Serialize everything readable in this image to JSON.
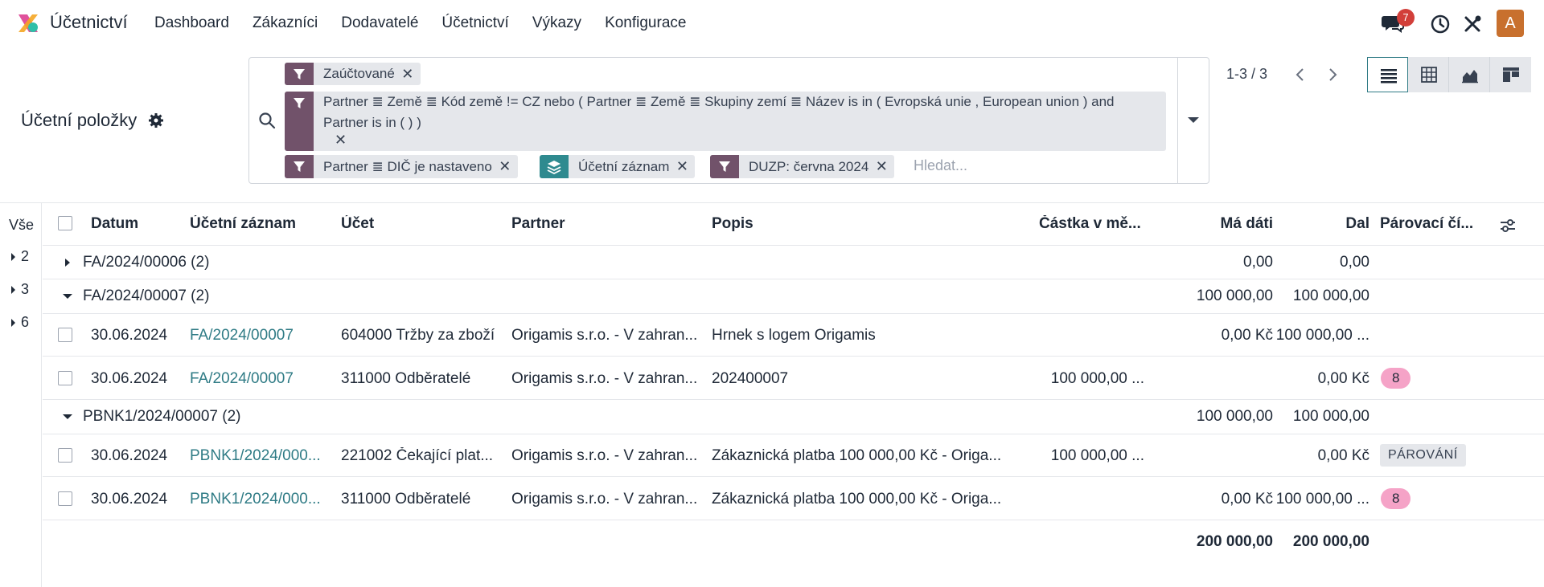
{
  "app": {
    "title": "Účetnictví"
  },
  "menu": [
    "Dashboard",
    "Zákazníci",
    "Dodavatelé",
    "Účetnictví",
    "Výkazy",
    "Konfigurace"
  ],
  "systray": {
    "messages_count": "7",
    "avatar_letter": "A"
  },
  "page": {
    "title": "Účetní položky"
  },
  "search": {
    "facets": [
      {
        "type": "filter",
        "label": "Zaúčtované"
      },
      {
        "type": "filter",
        "label_line1": "Partner ≣ Země ≣ Kód země != CZ nebo ( Partner ≣ Země ≣ Skupiny zemí ≣ Název is in ( Evropská unie , European union ) and",
        "label_line2": "Partner is in ( ) )"
      },
      {
        "type": "filter",
        "label": "Partner ≣ DIČ je nastaveno"
      },
      {
        "type": "groupby",
        "label": "Účetní záznam"
      },
      {
        "type": "filter",
        "label": "DUZP: června 2024"
      }
    ],
    "placeholder": "Hledat..."
  },
  "pager": {
    "value": "1-3 / 3"
  },
  "sidebar": {
    "all_label": "Vše",
    "items": [
      "2",
      "3",
      "6"
    ]
  },
  "table": {
    "headers": {
      "date": "Datum",
      "entry": "Účetní záznam",
      "account": "Účet",
      "partner": "Partner",
      "label": "Popis",
      "amount_currency": "Částka v mě...",
      "debit": "Má dáti",
      "credit": "Dal",
      "matching": "Párovací čí..."
    },
    "groups": [
      {
        "name": "FA/2024/00006 (2)",
        "debit": "0,00",
        "credit": "0,00",
        "open": false
      },
      {
        "name": "FA/2024/00007 (2)",
        "debit": "100 000,00",
        "credit": "100 000,00",
        "open": true
      },
      {
        "name": "PBNK1/2024/00007 (2)",
        "debit": "100 000,00",
        "credit": "100 000,00",
        "open": true
      }
    ],
    "rows": [
      {
        "date": "30.06.2024",
        "entry": "FA/2024/00007",
        "account": "604000 Tržby za zboží",
        "partner": "Origamis s.r.o. - V zahran...",
        "label": "Hrnek s logem Origamis",
        "amount_currency": "",
        "debit": "0,00 Kč",
        "credit": "100 000,00 ...",
        "matching": ""
      },
      {
        "date": "30.06.2024",
        "entry": "FA/2024/00007",
        "account": "311000 Odběratelé",
        "partner": "Origamis s.r.o. - V zahran...",
        "label": "202400007",
        "amount_currency": "100 000,00 ...",
        "debit": "0,00 Kč",
        "credit": "",
        "matching": "8"
      },
      {
        "date": "30.06.2024",
        "entry": "PBNK1/2024/000...",
        "account": "221002 Čekající plat...",
        "partner": "Origamis s.r.o. - V zahran...",
        "label": "Zákaznická platba 100 000,00 Kč - Origa...",
        "amount_currency": "100 000,00 ...",
        "debit": "0,00 Kč",
        "credit": "",
        "matching": "PÁROVÁNÍ"
      },
      {
        "date": "30.06.2024",
        "entry": "PBNK1/2024/000...",
        "account": "311000 Odběratelé",
        "partner": "Origamis s.r.o. - V zahran...",
        "label": "Zákaznická platba 100 000,00 Kč - Origa...",
        "amount_currency": "",
        "debit": "0,00 Kč",
        "credit": "100 000,00 ...",
        "matching": "8"
      }
    ],
    "totals": {
      "debit": "200 000,00",
      "credit": "200 000,00"
    }
  },
  "colors": {
    "facet_filter": "#71526a",
    "facet_groupby": "#2f8a8f",
    "link": "#2f7b85",
    "badge": "#d23f3a",
    "avatar": "#c8702e",
    "matching_tag": "#f5a3c7"
  }
}
